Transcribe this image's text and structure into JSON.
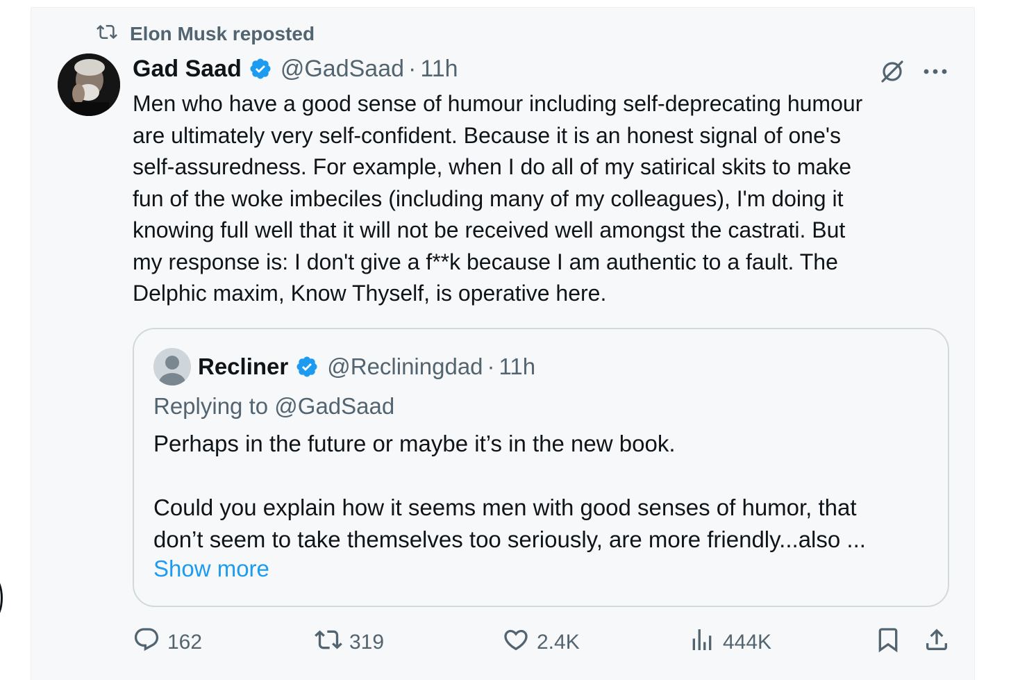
{
  "repost": {
    "icon": "repost-icon",
    "text": "Elon Musk reposted"
  },
  "tweet": {
    "author_name": "Gad Saad",
    "verified": true,
    "handle": "@GadSaad",
    "separator": "·",
    "time": "11h",
    "body": "Men who have a good sense of humour including self-deprecating humour\nare ultimately very self-confident.  Because it is an honest signal of one's\nself-assuredness.  For example, when I do all of my satirical skits to make\nfun of the woke imbeciles (including many of my colleagues), I'm doing it\nknowing full well that it will not be received well amongst the castrati.  But\nmy response is: I don't give a f**k because I am authentic to a fault.  The\nDelphic maxim, Know Thyself, is operative here."
  },
  "quote": {
    "author_name": "Recliner",
    "verified": true,
    "handle": "@Recliningdad",
    "separator": "·",
    "time": "11h",
    "replying_label": "Replying to",
    "replying_to": "@GadSaad",
    "text_line1": "Perhaps in the future or maybe it’s in the new book.",
    "text_para2": "Could you explain how it seems men with good senses of humor, that\ndon’t seem to take themselves too seriously, are more friendly...also ...",
    "show_more": "Show more"
  },
  "actions": {
    "replies": "162",
    "reposts": "319",
    "likes": "2.4K",
    "views": "444K"
  },
  "colors": {
    "text": "#0f1419",
    "secondary": "#536471",
    "accent": "#1d9bf0",
    "border": "#cfd9de",
    "card_bg": "#f7f8f9"
  }
}
